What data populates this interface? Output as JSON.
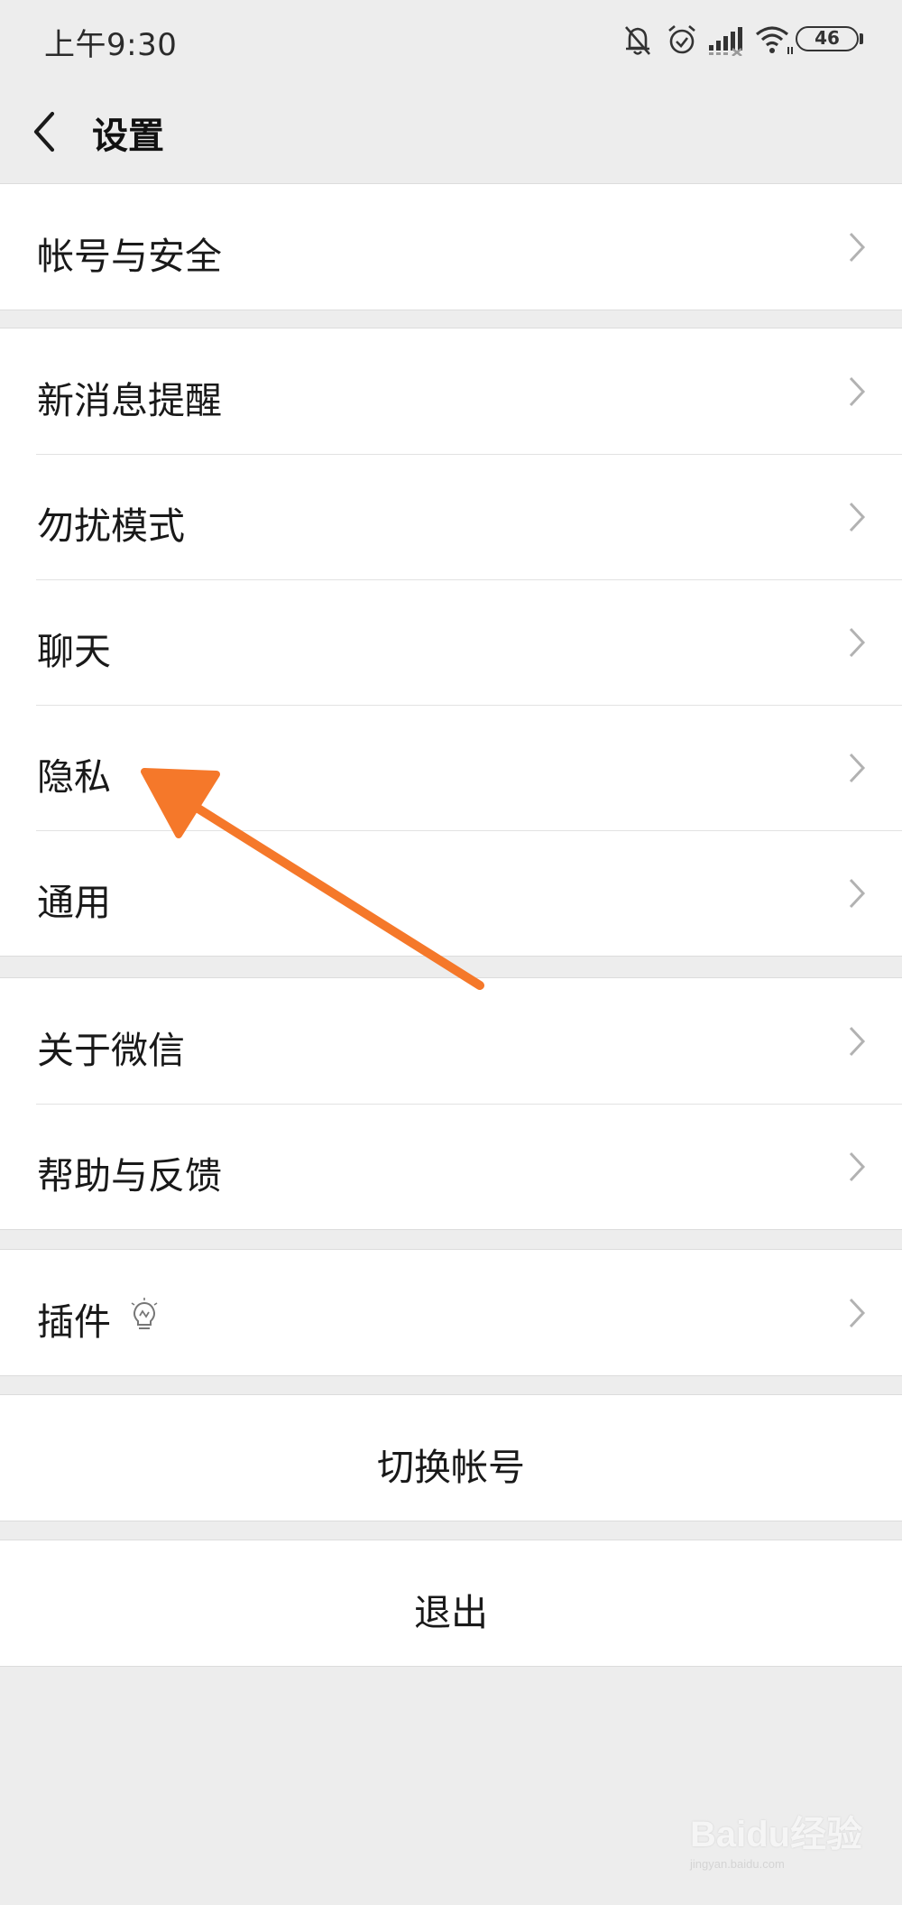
{
  "status_bar": {
    "time": "上午9:30",
    "battery": "46",
    "icons": [
      "mute-bell-icon",
      "alarm-icon",
      "signal-icon",
      "wifi-icon",
      "battery-icon"
    ]
  },
  "nav": {
    "title": "设置",
    "back_icon": "chevron-left-icon"
  },
  "groups": [
    {
      "items": [
        {
          "label": "帐号与安全"
        }
      ]
    },
    {
      "items": [
        {
          "label": "新消息提醒"
        },
        {
          "label": "勿扰模式"
        },
        {
          "label": "聊天"
        },
        {
          "label": "隐私"
        },
        {
          "label": "通用"
        }
      ]
    },
    {
      "items": [
        {
          "label": "关于微信"
        },
        {
          "label": "帮助与反馈"
        }
      ]
    },
    {
      "items": [
        {
          "label": "插件",
          "icon": "lightbulb-icon"
        }
      ]
    }
  ],
  "actions": {
    "switch_account": "切换帐号",
    "logout": "退出"
  },
  "annotation": {
    "arrow_color": "#f5782a",
    "points_to": "隐私"
  },
  "watermark": {
    "logo": "Baidu经验",
    "url": "jingyan.baidu.com"
  },
  "colors": {
    "background": "#ededed",
    "cell": "#ffffff",
    "chevron": "#b2b2b2",
    "text": "#191919"
  }
}
